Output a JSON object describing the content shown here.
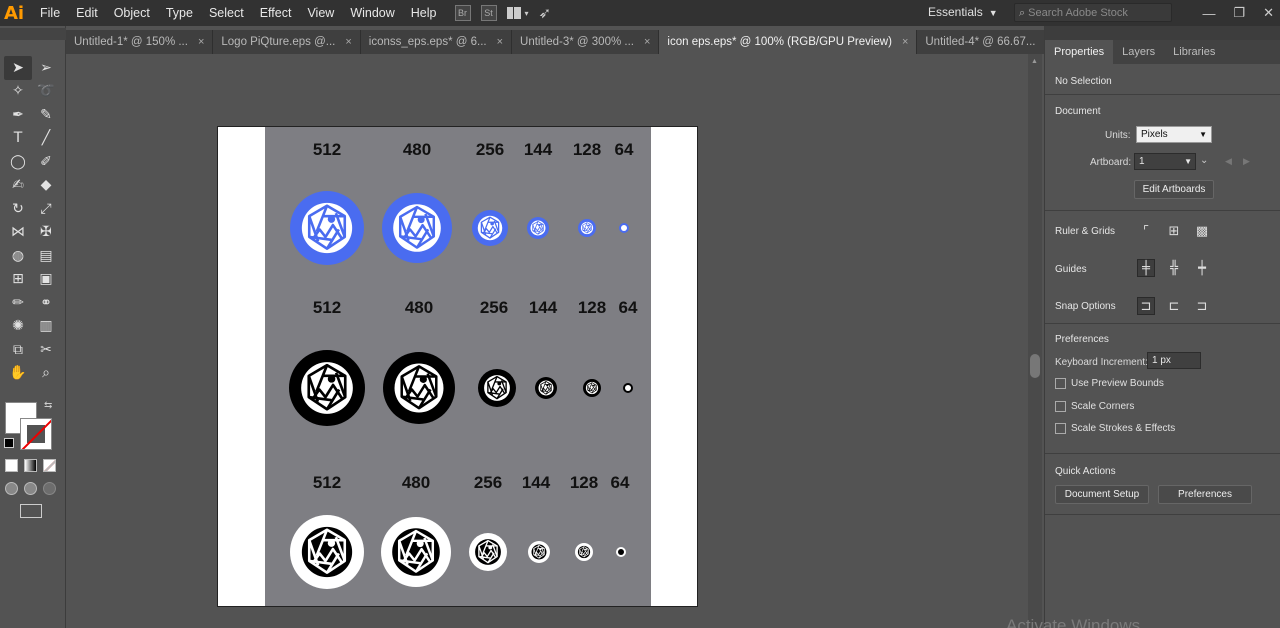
{
  "app": {
    "logo": "Ai",
    "title": "Adobe Illustrator"
  },
  "menu": [
    "File",
    "Edit",
    "Object",
    "Type",
    "Select",
    "Effect",
    "View",
    "Window",
    "Help"
  ],
  "toolbar_icons": [
    "bridge-icon",
    "stock-icon",
    "arrange-documents-icon",
    "gpu-performance-icon"
  ],
  "toolbar_labels": {
    "br": "Br",
    "st": "St"
  },
  "workspace": {
    "label": "Essentials",
    "chevron": "⌄"
  },
  "search": {
    "placeholder": "Search Adobe Stock"
  },
  "window_controls": {
    "minimize": "—",
    "restore": "❐",
    "close": "✕"
  },
  "tabs": [
    {
      "label": "Untitled-1* @ 150% ...",
      "active": false
    },
    {
      "label": "Logo PiQture.eps @...",
      "active": false
    },
    {
      "label": "iconss_eps.eps* @ 6...",
      "active": false
    },
    {
      "label": "Untitled-3* @ 300% ...",
      "active": false
    },
    {
      "label": "icon eps.eps* @ 100% (RGB/GPU Preview)",
      "active": true
    },
    {
      "label": "Untitled-4* @ 66.67...",
      "active": false
    }
  ],
  "tab_close": "×",
  "artboard": {
    "rows": [
      {
        "style": "blue",
        "labels": [
          "512",
          "480",
          "256",
          "144",
          "128",
          "64"
        ]
      },
      {
        "style": "black-ring",
        "labels": [
          "512",
          "480",
          "256",
          "144",
          "128",
          "64"
        ]
      },
      {
        "style": "white-ring",
        "labels": [
          "512",
          "480",
          "256",
          "144",
          "128",
          "64"
        ]
      }
    ],
    "colors": {
      "blue": "#4a6cf0",
      "black": "#000000",
      "white": "#ffffff",
      "grey": "#7e7e83"
    }
  },
  "panel": {
    "tabs": [
      "Properties",
      "Layers",
      "Libraries"
    ],
    "selection": "No Selection",
    "document": {
      "title": "Document",
      "units_label": "Units:",
      "units_value": "Pixels",
      "artboard_label": "Artboard:",
      "artboard_value": "1",
      "edit_artboards": "Edit Artboards"
    },
    "ruler_grids": "Ruler & Grids",
    "guides": "Guides",
    "snap_options": "Snap Options",
    "preferences": {
      "title": "Preferences",
      "keyboard_label": "Keyboard Increment:",
      "keyboard_value": "1 px",
      "use_preview_bounds": "Use Preview Bounds",
      "scale_corners": "Scale Corners",
      "scale_strokes": "Scale Strokes & Effects"
    },
    "quick_actions": {
      "title": "Quick Actions",
      "document_setup": "Document Setup",
      "preferences": "Preferences"
    }
  },
  "watermark": "Activate Windows"
}
